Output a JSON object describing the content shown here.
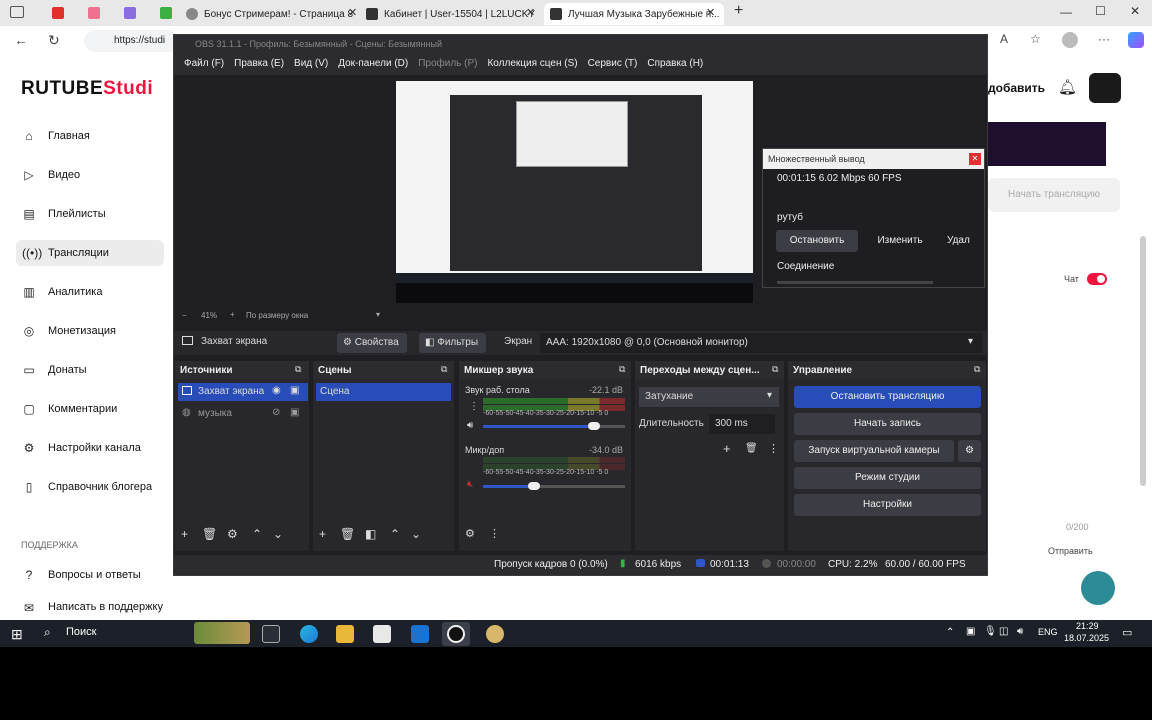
{
  "browser": {
    "tabs": [
      {
        "label": "Бонус Стримерам! - Страница 8"
      },
      {
        "label": "Кабинет | User-15504 | L2LUCKY"
      },
      {
        "label": "Лучшая Музыка Зарубежные п..."
      }
    ],
    "url": "https://studi"
  },
  "rutube": {
    "logo_main": "RUTUBE",
    "logo_accent": "Studi",
    "nav": [
      {
        "label": "Главная"
      },
      {
        "label": "Видео"
      },
      {
        "label": "Плейлисты"
      },
      {
        "label": "Трансляции"
      },
      {
        "label": "Аналитика"
      },
      {
        "label": "Монетизация"
      },
      {
        "label": "Донаты"
      },
      {
        "label": "Комментарии"
      },
      {
        "label": "Настройки канала"
      },
      {
        "label": "Справочник блогера"
      }
    ],
    "support_header": "ПОДДЕРЖКА",
    "support_items": [
      {
        "label": "Вопросы и ответы"
      },
      {
        "label": "Написать в поддержку"
      }
    ],
    "add_button": "добавить",
    "start_broadcast": "Начать трансляцию",
    "chat_label": "Чат",
    "char_count": "0/200",
    "send_label": "Отправить"
  },
  "obs": {
    "title": "OBS 31.1.1 - Профиль: Безымянный - Сцены: Безымянный",
    "menu": [
      "Файл (F)",
      "Правка (E)",
      "Вид (V)",
      "Док-панели (D)",
      "Профиль (P)",
      "Коллекция сцен (S)",
      "Сервис (T)",
      "Справка (H)"
    ],
    "zoom": "41%",
    "zoom_mode": "По размеру окна",
    "source_bar": {
      "source_name": "Захват экрана",
      "props": "Свойства",
      "filters": "Фильтры",
      "screen_label": "Экран",
      "screen_value": "AAA: 1920x1080 @ 0,0 (Основной монитор)"
    },
    "sources": {
      "header": "Источники",
      "items": [
        "Захват экрана",
        "музыка"
      ]
    },
    "scenes": {
      "header": "Сцены",
      "items": [
        "Сцена"
      ]
    },
    "mixer": {
      "header": "Микшер звука",
      "scale": "-60-55-50-45-40-35-30-25-20-15-10 -5  0",
      "channels": [
        {
          "name": "Звук раб. стола",
          "db": "-22.1 dB",
          "level": 0.84,
          "volume": 0.78
        },
        {
          "name": "Микр/доп",
          "db": "-34.0 dB",
          "level": 0.0,
          "volume": 0.36
        }
      ]
    },
    "transitions": {
      "header": "Переходы между сцен...",
      "type": "Затухание",
      "duration_label": "Длительность",
      "duration": "300 ms"
    },
    "controls": {
      "header": "Управление",
      "stop_stream": "Остановить трансляцию",
      "start_record": "Начать запись",
      "virtual_cam": "Запуск виртуальной камеры",
      "studio_mode": "Режим студии",
      "settings": "Настройки"
    },
    "status": {
      "dropped": "Пропуск кадров 0 (0.0%)",
      "kbps": "6016 kbps",
      "stream_time": "00:01:13",
      "rec_time": "00:00:00",
      "cpu": "CPU: 2.2%",
      "fps": "60.00 / 60.00 FPS"
    }
  },
  "multi_output": {
    "title": "Множественный вывод",
    "stats": "00:01:15  6.02 Mbps  60 FPS",
    "target_name": "рутуб",
    "stop": "Остановить",
    "edit": "Изменить",
    "delete": "Удал",
    "connection": "Соединение"
  },
  "taskbar": {
    "search": "Поиск",
    "lang": "ENG",
    "time": "21:29",
    "date": "18.07.2025"
  },
  "colors": {
    "accent_red": "#ed143d",
    "obs_blue": "#284cb8"
  }
}
